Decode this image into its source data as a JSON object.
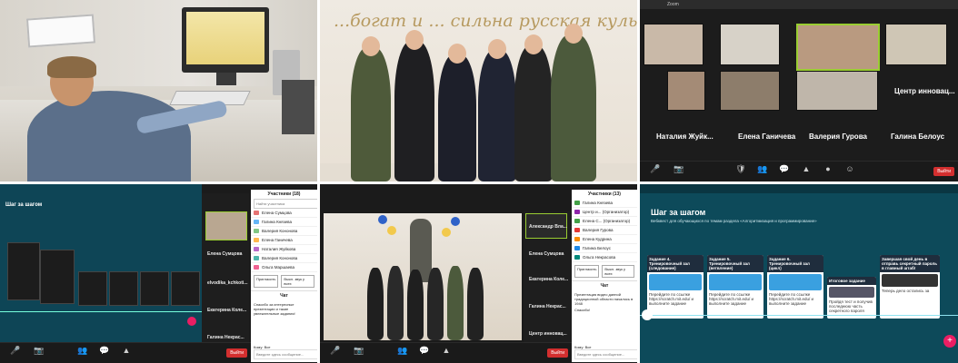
{
  "tile2": {
    "wall_text": "...богат и ... сильна русская культура"
  },
  "tile3": {
    "tab_label": "Zoom",
    "names": [
      "Наталия Жуйк...",
      "Елена Ганичева",
      "Валерия Гурова",
      "Галина Белоус"
    ],
    "center_label": "Центр инновац...",
    "end_button": "Выйти"
  },
  "tile4": {
    "panel_title": "Участники (18)",
    "search_placeholder": "Найти участника",
    "participants": [
      "Елена Сумцова",
      "Галина Князева",
      "Валерия Кононова",
      "Елена Ганичева",
      "Наталия Жуйкова",
      "Валерия Кононова",
      "Ольга Маршаева"
    ],
    "invite_btn": "Пригласить",
    "mute_btn": "Выкл. звук у всех",
    "chat_title": "Чат",
    "chat_msg1": "Спасибо за интересные презентации и такие увлекательные задания!",
    "side_names": [
      "Елена Сумцова",
      "elvodika_kchkoti...",
      "Екатерина Коле...",
      "Галина Некрас..."
    ],
    "slide_heading": "Шаг за шагом",
    "send_label": "Кому:",
    "send_target": "Все",
    "input_placeholder": "Введите здесь сообщение...",
    "end_button": "Выйти"
  },
  "tile5": {
    "panel_title": "Участники (13)",
    "participants": [
      "Галина Князева",
      "Центр и... (Организатор)",
      "Елена С... (Организатор)",
      "Валерия Гурова",
      "Елена Кудрина",
      "Галина Белоус",
      "Ольга Некрасова"
    ],
    "invite_btn": "Пригласить",
    "mute_btn": "Выкл. звук у всех",
    "chat_title": "Чат",
    "chat_msg1": "Презентация видео данной традиционной области началось в 1948",
    "chat_msg2": "Спасибо!",
    "side_names": [
      "Александр Вла...",
      "Елена Сумцова",
      "Екатерина Коле...",
      "Галина Некрас...",
      "Центр инновац..."
    ],
    "send_label": "Кому:",
    "send_target": "Все",
    "input_placeholder": "Введите здесь сообщение...",
    "end_button": "Выйти"
  },
  "tile6": {
    "title": "Шаг за шагом",
    "subtitle": "Вебквест для обучающихся по темам раздела «Алгоритмизация и программирование»",
    "cards": [
      {
        "head": "Задание 4. Тренировочный зал (следование)",
        "body": "Перейдите по ссылке https://scratch.mit.edu/ и выполните задание"
      },
      {
        "head": "Задание 5. Тренировочный зал (ветвление)",
        "body": "Перейдите по ссылке https://scratch.mit.edu/ и выполните задание"
      },
      {
        "head": "Задание 6. Тренировочный зал (цикл)",
        "body": "Перейдите по ссылке https://scratch.mit.edu/ и выполните задание"
      },
      {
        "head": "Итоговое задание",
        "body": "Пройдя тест и получив последнюю часть секретного пароля"
      },
      {
        "head": "Завершая свой день в отправь секретный пароль в главный штаб!",
        "body": "Теперь дело остались за"
      }
    ]
  }
}
